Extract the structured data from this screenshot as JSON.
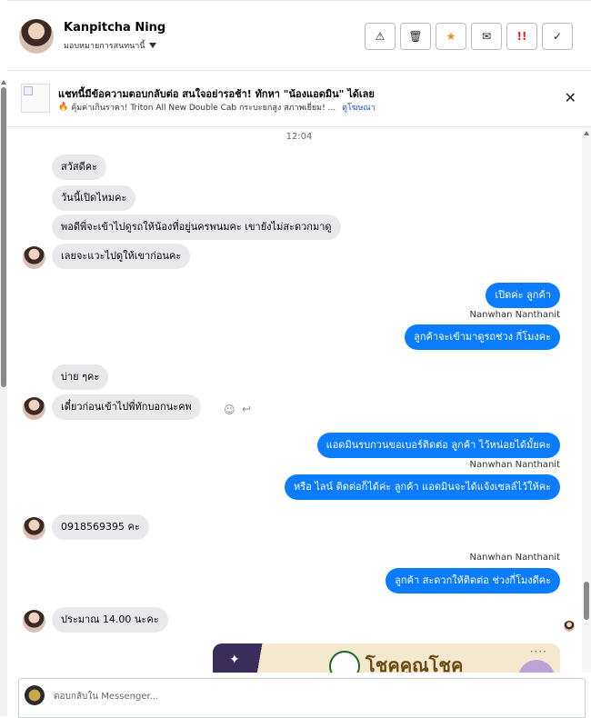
{
  "contact": {
    "name": "Kanpitcha Ning",
    "assign_label": "มอบหมายการสนทนานี้"
  },
  "actions": [
    {
      "name": "alert-button",
      "glyph": "⚠"
    },
    {
      "name": "delete-button",
      "glyph": "🗑"
    },
    {
      "name": "star-button",
      "glyph": "★"
    },
    {
      "name": "mail-button",
      "glyph": "✉"
    },
    {
      "name": "urgent-button",
      "glyph": "!!"
    },
    {
      "name": "done-button",
      "glyph": "✓"
    }
  ],
  "notice": {
    "title": "แชทนี้มีข้อความตอบกลับต่อ สนใจอย่ารอช้า! ทักหา \"น้องแอดมิน\" ได้เลย",
    "subtitle": "คุ้มค่าเกินราคา! Triton All New Double Cab กระบะยกสูง สภาพเยี่ยม! ...",
    "link": "ดูโฆษณา"
  },
  "chat": {
    "timestamp": "12:04",
    "messages": [
      {
        "dir": "in",
        "text": "สวัสดีคะ"
      },
      {
        "dir": "in",
        "text": "วันนี้เปิดไหมคะ"
      },
      {
        "dir": "in",
        "text": "พอดีพี่จะเข้าไปดูรถให้น้องที่อยู่นครพนมคะ เขายังไม่สะดวกมาดู"
      },
      {
        "dir": "in",
        "text": "เลยจะแวะไปดูให้เขาก่อนคะ"
      },
      {
        "dir": "out",
        "text": "เปิดค่ะ ลูกค้า"
      },
      {
        "dir": "out",
        "text": "ลูกค้าจะเข้ามาดูรถช่วง กี่โมงคะ",
        "sender": "Nanwhan Nanthanit"
      },
      {
        "dir": "in",
        "text": "บ่าย ๆคะ"
      },
      {
        "dir": "in",
        "text": "เดี๋ยวก่อนเข้าไปพี่ทักบอกนะคพ"
      },
      {
        "dir": "out",
        "text": "แอดมินรบกวนขอเบอร์ติดต่อ ลูกค้า ไว้หน่อยได้มั้ยคะ"
      },
      {
        "dir": "out",
        "text": "หรือ ไลน์ ติดต่อก็ได้ค่ะ ลูกค้า แอดมินจะได้แจ้งเซลล์ไว้ให้คะ",
        "sender": "Nanwhan Nanthanit"
      },
      {
        "dir": "in",
        "text": "0918569395 คะ"
      },
      {
        "dir": "out",
        "text": "ลูกค้า สะดวกให้ติดต่อ ช่วงกี่โมงดีคะ",
        "sender": "Nanwhan Nanthanit"
      },
      {
        "dir": "in",
        "text": "ประมาณ 14.00 นะคะ"
      }
    ],
    "card_brand": "โชคคูณโชค"
  },
  "composer": {
    "placeholder": "ตอบกลับใน Messenger..."
  }
}
